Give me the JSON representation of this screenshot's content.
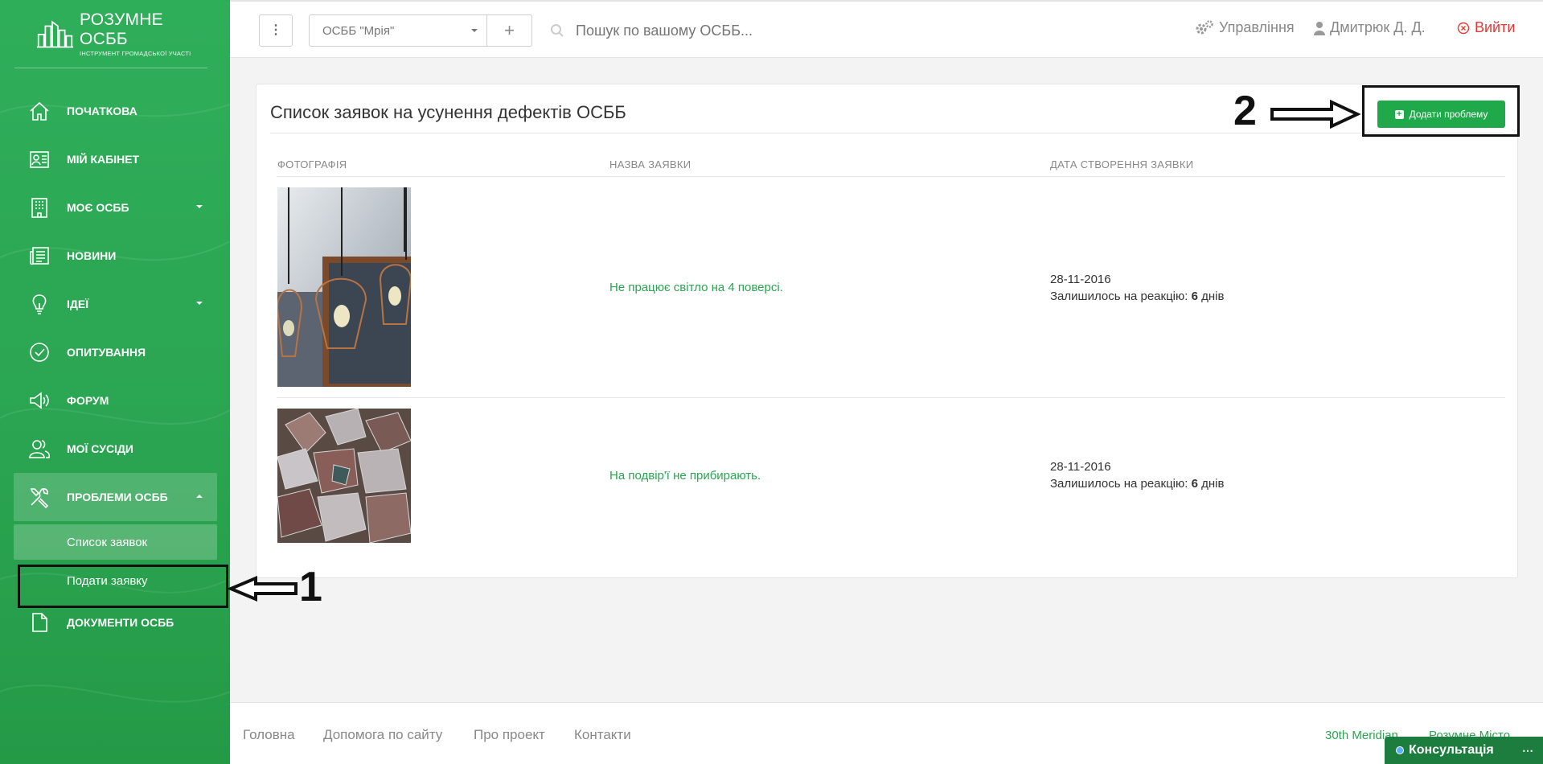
{
  "sidebar": {
    "logo": {
      "title": "РОЗУМНЕ ОСББ",
      "subtitle": "ІНСТРУМЕНТ ГРОМАДСЬКОЇ УЧАСТІ"
    },
    "items": [
      {
        "label": "ПОЧАТКОВА",
        "icon": "home-icon"
      },
      {
        "label": "МІЙ КАБІНЕТ",
        "icon": "profile-card-icon"
      },
      {
        "label": "МОЄ ОСББ",
        "icon": "building-icon"
      },
      {
        "label": "НОВИНИ",
        "icon": "newspaper-icon"
      },
      {
        "label": "ІДЕЇ",
        "icon": "lightbulb-icon"
      },
      {
        "label": "ОПИТУВАННЯ",
        "icon": "check-circle-icon"
      },
      {
        "label": "ФОРУМ",
        "icon": "megaphone-icon"
      },
      {
        "label": "МОЇ СУСІДИ",
        "icon": "neighbors-icon"
      },
      {
        "label": "ПРОБЛЕМИ ОСББ",
        "icon": "tools-icon"
      },
      {
        "label": "ДОКУМЕНТИ ОСББ",
        "icon": "document-icon"
      }
    ],
    "subitems": [
      {
        "label": "Список заявок"
      },
      {
        "label": "Подати заявку"
      }
    ]
  },
  "header": {
    "osbb_value": "ОСББ \"Мрія\"",
    "search_placeholder": "Пошук по вашому ОСББ...",
    "manage_label": "Управління",
    "user_label": "Дмитрюк Д. Д.",
    "logout_label": "Вийти"
  },
  "main": {
    "title": "Список заявок на усунення дефектів ОСББ",
    "add_button": "Додати проблему",
    "columns": [
      "ФОТОГРАФІЯ",
      "НАЗВА ЗАЯВКИ",
      "ДАТА СТВОРЕННЯ ЗАЯВКИ"
    ],
    "rows": [
      {
        "name": "Не працює світло на 4 поверсі.",
        "date": "28-11-2016",
        "remaining_label": "Залишилось на реакцію:",
        "remaining_days": "6",
        "days_word": "днів"
      },
      {
        "name": "На подвір'ї не прибирають.",
        "date": "28-11-2016",
        "remaining_label": "Залишилось на реакцію:",
        "remaining_days": "6",
        "days_word": "днів"
      }
    ]
  },
  "annotations": {
    "one": "1",
    "two": "2"
  },
  "footer": {
    "links": [
      "Головна",
      "Допомога по сайту",
      "Про проект",
      "Контакти"
    ],
    "right_links": [
      "30th Meridian",
      "Розумне Місто"
    ],
    "consult_label": "Консультація"
  },
  "colors": {
    "brand_green": "#2ba552",
    "button_green": "#20a94b",
    "logout_red": "#e53935"
  }
}
